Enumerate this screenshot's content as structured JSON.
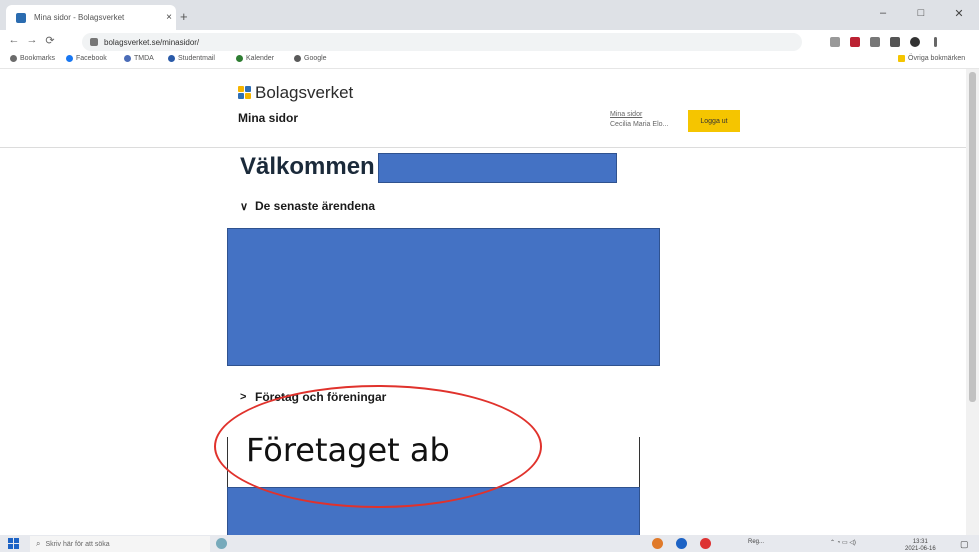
{
  "browser": {
    "tab_title": "Mina sidor - Bolagsverket",
    "tab_close": "×",
    "new_tab": "+",
    "url": "bolagsverket.se/minasidor/",
    "nav_back": "←",
    "nav_forward": "→",
    "nav_reload": "⟳",
    "win_min": "–",
    "win_max": "□",
    "win_close": "✕",
    "bookmarks": [
      "Bookmarks",
      "Facebook",
      "TMDA",
      "Studentmail",
      "Kalender",
      "Google"
    ],
    "bookmark_colors": [
      "#6b6b6b",
      "#1877f2",
      "#4b6cb7",
      "#2a5aa8",
      "#2e7d32",
      "#5a5a5a"
    ],
    "other_bookmarks": "Övriga bokmärken"
  },
  "header": {
    "logo_text": "Bolagsverket",
    "subtitle": "Mina sidor",
    "account_line1": "Mina sidor",
    "account_line2": "Cecilia Maria Elo...",
    "login_button": "Logga ut"
  },
  "main": {
    "welcome": "Välkommen",
    "section_recent": "De senaste ärendena",
    "section_companies": "Företag och föreningar",
    "company_name": "Företaget ab",
    "chevron": "∨",
    "chevron_right": ">"
  },
  "taskbar": {
    "search_placeholder": "Skriv här för att söka",
    "search_icon": "⌕",
    "tray_text": "Reg...",
    "time": "13:31",
    "date": "2021-06-16"
  },
  "colors": {
    "redaction": "#4472c4",
    "annotation": "#e0322c",
    "login_button": "#f5c500"
  }
}
